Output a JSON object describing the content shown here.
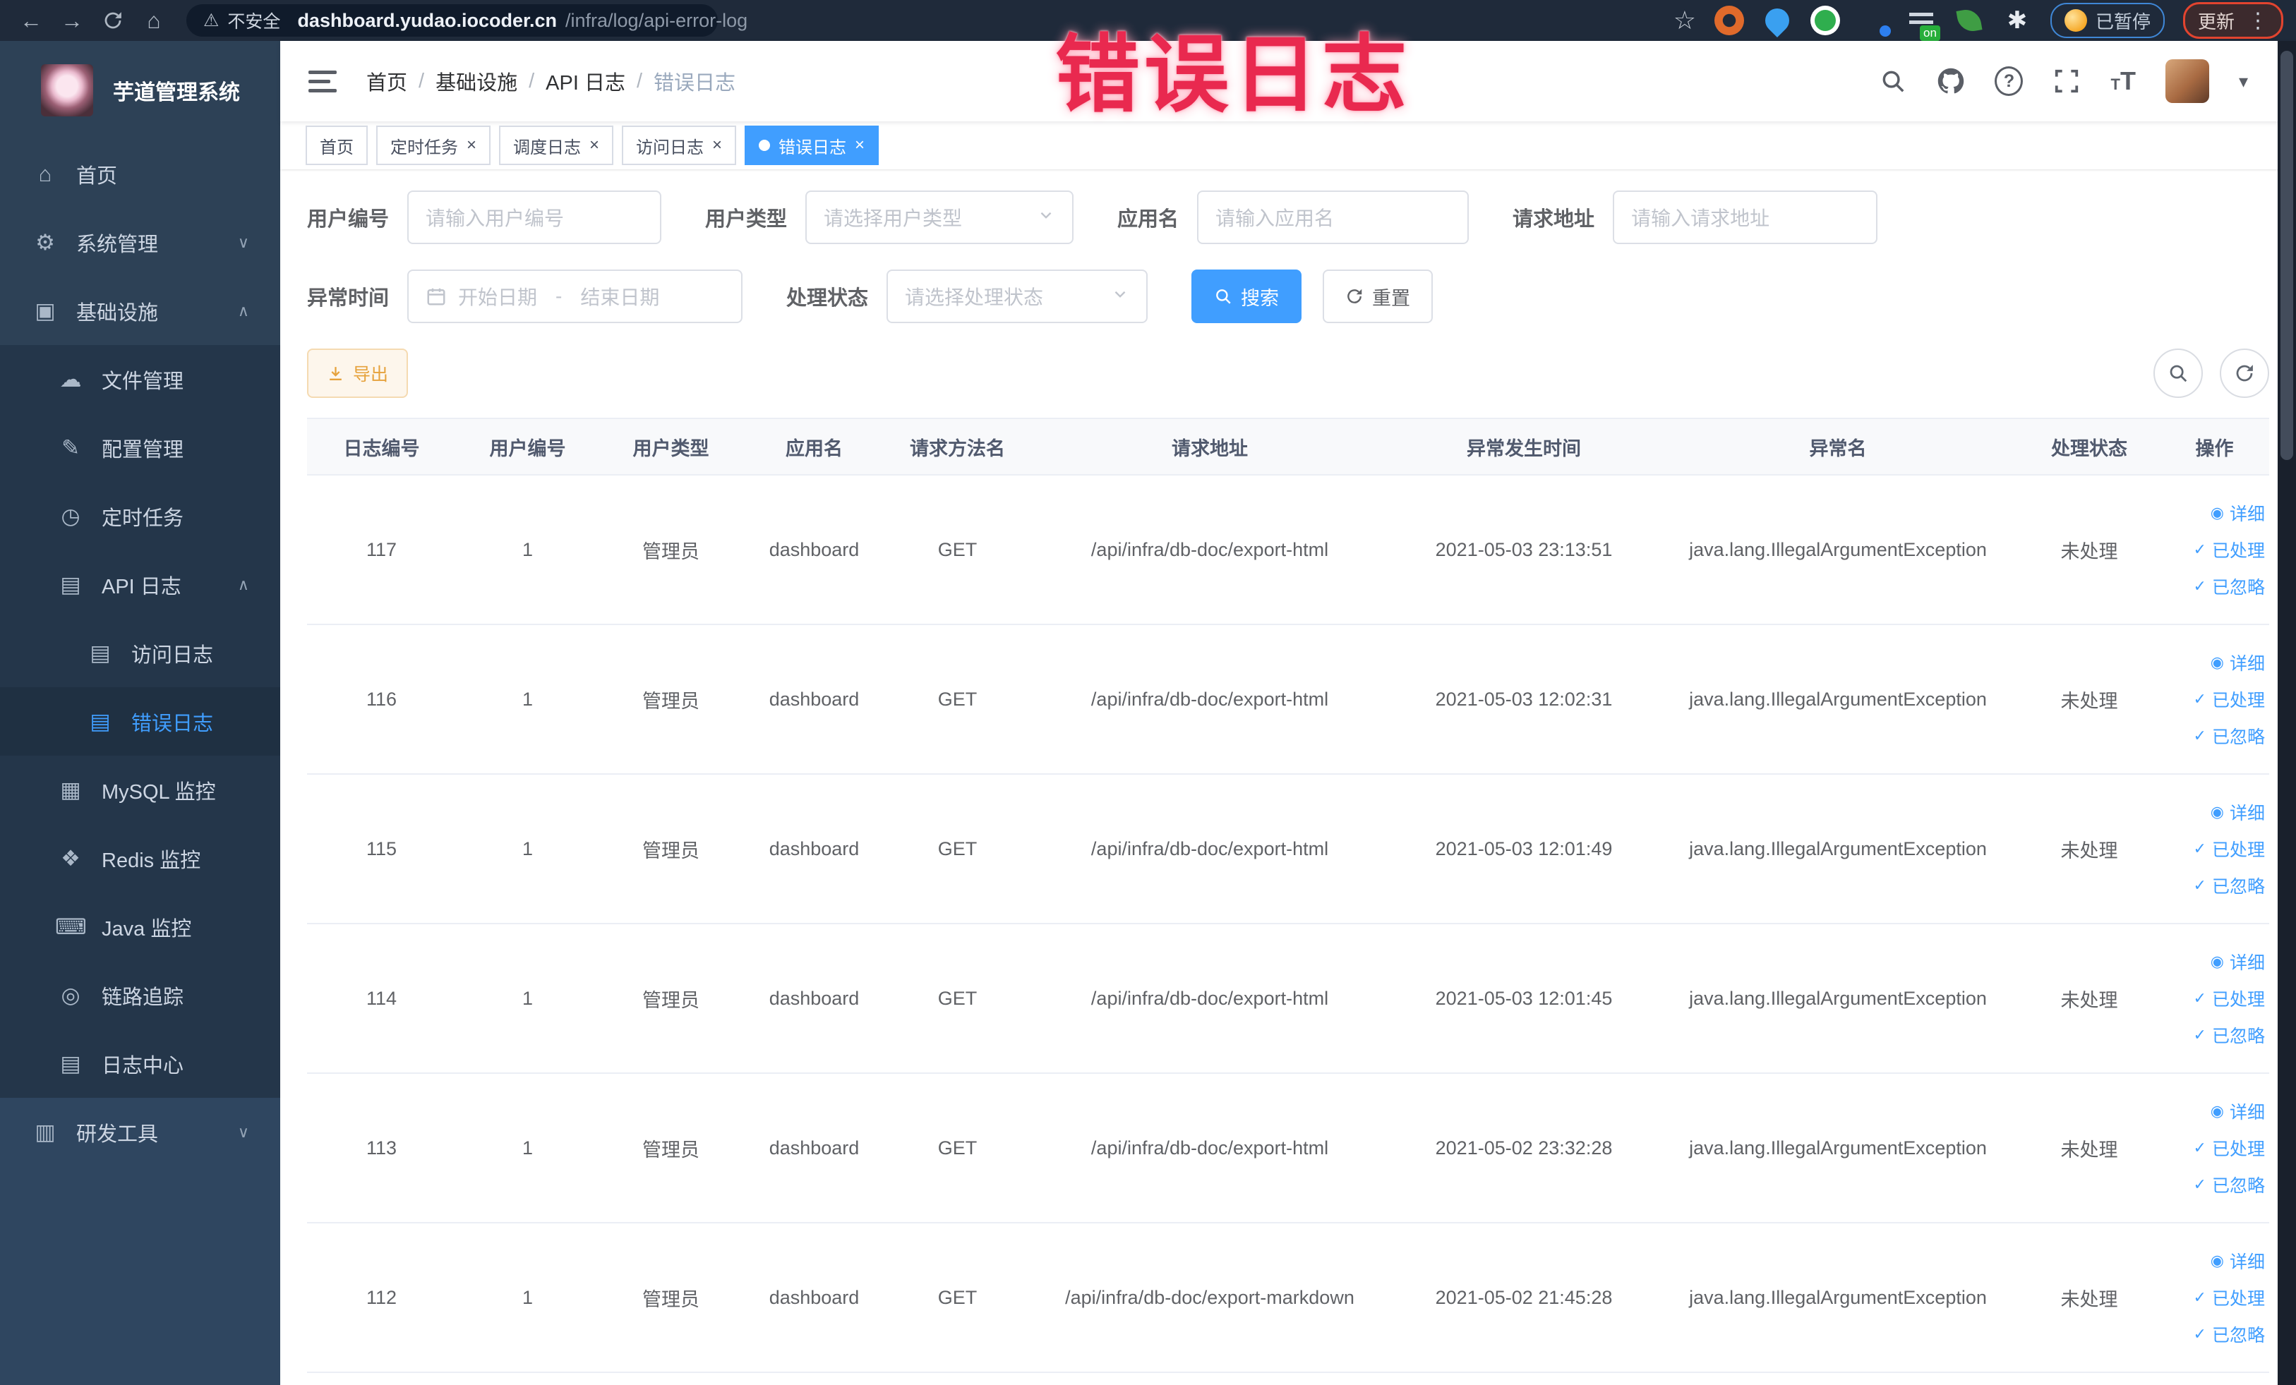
{
  "annotation": {
    "text": "错误日志",
    "color": "#e9294f"
  },
  "browser": {
    "nav": {
      "back": "←",
      "forward": "→",
      "home": "⌂"
    },
    "security_label": "不安全",
    "url_host": "dashboard.yudao.iocoder.cn",
    "url_path": "/infra/log/api-error-log",
    "bookmark_star": "☆",
    "extensions": [
      "proxy-icon",
      "pin-icon",
      "v-badge-icon",
      "grid-icon",
      "switch-on-icon",
      "leaf-icon",
      "puzzle-icon"
    ],
    "on_badge": "on",
    "paused_button": "已暂停",
    "update_button": "更新",
    "kebab": "⋮"
  },
  "sidebar": {
    "title": "芋道管理系统",
    "menu": [
      {
        "label": "首页",
        "icon": "home-icon",
        "glyph": "⌂",
        "level": 0,
        "zone": "base"
      },
      {
        "label": "系统管理",
        "icon": "gear-icon",
        "glyph": "⚙",
        "level": 0,
        "zone": "base",
        "arrow": "down"
      },
      {
        "label": "基础设施",
        "icon": "monitor-icon",
        "glyph": "▣",
        "level": 0,
        "zone": "base",
        "arrow": "up"
      },
      {
        "label": "文件管理",
        "icon": "cloud-icon",
        "glyph": "☁",
        "level": 1,
        "zone": "sub"
      },
      {
        "label": "配置管理",
        "icon": "edit-icon",
        "glyph": "✎",
        "level": 1,
        "zone": "sub"
      },
      {
        "label": "定时任务",
        "icon": "timer-icon",
        "glyph": "◷",
        "level": 1,
        "zone": "sub"
      },
      {
        "label": "API 日志",
        "icon": "api-log-icon",
        "glyph": "▤",
        "level": 1,
        "zone": "sub",
        "arrow": "up"
      },
      {
        "label": "访问日志",
        "icon": "access-log-icon",
        "glyph": "▤",
        "level": 2,
        "zone": "sub"
      },
      {
        "label": "错误日志",
        "icon": "error-log-icon",
        "glyph": "▤",
        "level": 2,
        "zone": "sub",
        "active": true
      },
      {
        "label": "MySQL 监控",
        "icon": "mysql-icon",
        "glyph": "▦",
        "level": 1,
        "zone": "sub"
      },
      {
        "label": "Redis 监控",
        "icon": "redis-icon",
        "glyph": "❖",
        "level": 1,
        "zone": "sub"
      },
      {
        "label": "Java 监控",
        "icon": "java-icon",
        "glyph": "⌨",
        "level": 1,
        "zone": "sub"
      },
      {
        "label": "链路追踪",
        "icon": "trace-icon",
        "glyph": "◎",
        "level": 1,
        "zone": "sub"
      },
      {
        "label": "日志中心",
        "icon": "log-center-icon",
        "glyph": "▤",
        "level": 1,
        "zone": "sub"
      },
      {
        "label": "研发工具",
        "icon": "toolbox-icon",
        "glyph": "▥",
        "level": 0,
        "zone": "base2",
        "arrow": "down"
      }
    ]
  },
  "navbar": {
    "breadcrumb": [
      "首页",
      "基础设施",
      "API 日志",
      "错误日志"
    ],
    "icons": [
      "search-icon",
      "github-icon",
      "help-icon",
      "fullscreen-icon",
      "font-size-icon",
      "avatar",
      "caret-down-icon"
    ]
  },
  "tags": [
    {
      "label": "首页",
      "closable": false,
      "active": false
    },
    {
      "label": "定时任务",
      "closable": true,
      "active": false
    },
    {
      "label": "调度日志",
      "closable": true,
      "active": false
    },
    {
      "label": "访问日志",
      "closable": true,
      "active": false
    },
    {
      "label": "错误日志",
      "closable": true,
      "active": true
    }
  ],
  "filters": {
    "user_id": {
      "label": "用户编号",
      "placeholder": "请输入用户编号"
    },
    "user_type": {
      "label": "用户类型",
      "placeholder": "请选择用户类型"
    },
    "app_name": {
      "label": "应用名",
      "placeholder": "请输入应用名"
    },
    "request_url": {
      "label": "请求地址",
      "placeholder": "请输入请求地址"
    },
    "exception_time": {
      "label": "异常时间",
      "start_placeholder": "开始日期",
      "separator": "-",
      "end_placeholder": "结束日期"
    },
    "process_status": {
      "label": "处理状态",
      "placeholder": "请选择处理状态"
    },
    "search_button": "搜索",
    "reset_button": "重置"
  },
  "toolbar": {
    "export_button": "导出"
  },
  "table": {
    "columns": [
      "日志编号",
      "用户编号",
      "用户类型",
      "应用名",
      "请求方法名",
      "请求地址",
      "异常发生时间",
      "异常名",
      "处理状态",
      "操作"
    ],
    "actions": [
      "详细",
      "已处理",
      "已忽略"
    ],
    "rows": [
      {
        "id": "117",
        "user_id": "1",
        "user_type": "管理员",
        "app": "dashboard",
        "method": "GET",
        "url": "/api/infra/db-doc/export-html",
        "time": "2021-05-03 23:13:51",
        "exception": "java.lang.IllegalArgumentException",
        "status": "未处理"
      },
      {
        "id": "116",
        "user_id": "1",
        "user_type": "管理员",
        "app": "dashboard",
        "method": "GET",
        "url": "/api/infra/db-doc/export-html",
        "time": "2021-05-03 12:02:31",
        "exception": "java.lang.IllegalArgumentException",
        "status": "未处理"
      },
      {
        "id": "115",
        "user_id": "1",
        "user_type": "管理员",
        "app": "dashboard",
        "method": "GET",
        "url": "/api/infra/db-doc/export-html",
        "time": "2021-05-03 12:01:49",
        "exception": "java.lang.IllegalArgumentException",
        "status": "未处理"
      },
      {
        "id": "114",
        "user_id": "1",
        "user_type": "管理员",
        "app": "dashboard",
        "method": "GET",
        "url": "/api/infra/db-doc/export-html",
        "time": "2021-05-03 12:01:45",
        "exception": "java.lang.IllegalArgumentException",
        "status": "未处理"
      },
      {
        "id": "113",
        "user_id": "1",
        "user_type": "管理员",
        "app": "dashboard",
        "method": "GET",
        "url": "/api/infra/db-doc/export-html",
        "time": "2021-05-02 23:32:28",
        "exception": "java.lang.IllegalArgumentException",
        "status": "未处理"
      },
      {
        "id": "112",
        "user_id": "1",
        "user_type": "管理员",
        "app": "dashboard",
        "method": "GET",
        "url": "/api/infra/db-doc/export-markdown",
        "time": "2021-05-02 21:45:28",
        "exception": "java.lang.IllegalArgumentException",
        "status": "未处理"
      }
    ]
  },
  "colors": {
    "accent": "#409eff",
    "warning": "#e6a23c",
    "sidebar_bg": "#2d4156",
    "annotation": "#e9294f"
  }
}
